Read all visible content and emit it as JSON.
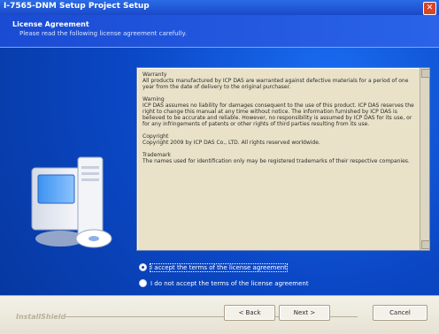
{
  "window": {
    "title": "I-7565-DNM Setup Project Setup",
    "header_title": "License Agreement",
    "header_subtitle": "Please read the following license agreement carefully."
  },
  "license": {
    "text": "Warranty\nAll products manufactured by ICP DAS are warranted against defective materials for a period of one year from the date of delivery to the original purchaser.\n\nWarning\nICP DAS assumes no liability for damages consequent to the use of this product. ICP DAS reserves the right to change this manual at any time without notice. The information furnished by ICP DAS is believed to be accurate and reliable. However, no responsibility is assumed by ICP DAS for its use, or for any infringements of patents or other rights of third parties resulting from its use.\n\nCopyright\nCopyright 2009 by ICP DAS Co., LTD. All rights reserved worldwide.\n\nTrademark\nThe names used for identification only may be registered trademarks of their respective companies."
  },
  "options": {
    "accept_label": "I accept the terms of the license agreement",
    "decline_label": "I do not accept the terms of the license agreement",
    "selected": "accept"
  },
  "footer": {
    "brand": "InstallShield",
    "back_label": "< Back",
    "next_label": "Next >",
    "cancel_label": "Cancel"
  },
  "colors": {
    "title_bar": "#1a49c9",
    "panel_bg": "#0b48c6",
    "license_bg": "#e9e2c9"
  },
  "icons": [
    "close-icon",
    "computer-install-icon"
  ]
}
